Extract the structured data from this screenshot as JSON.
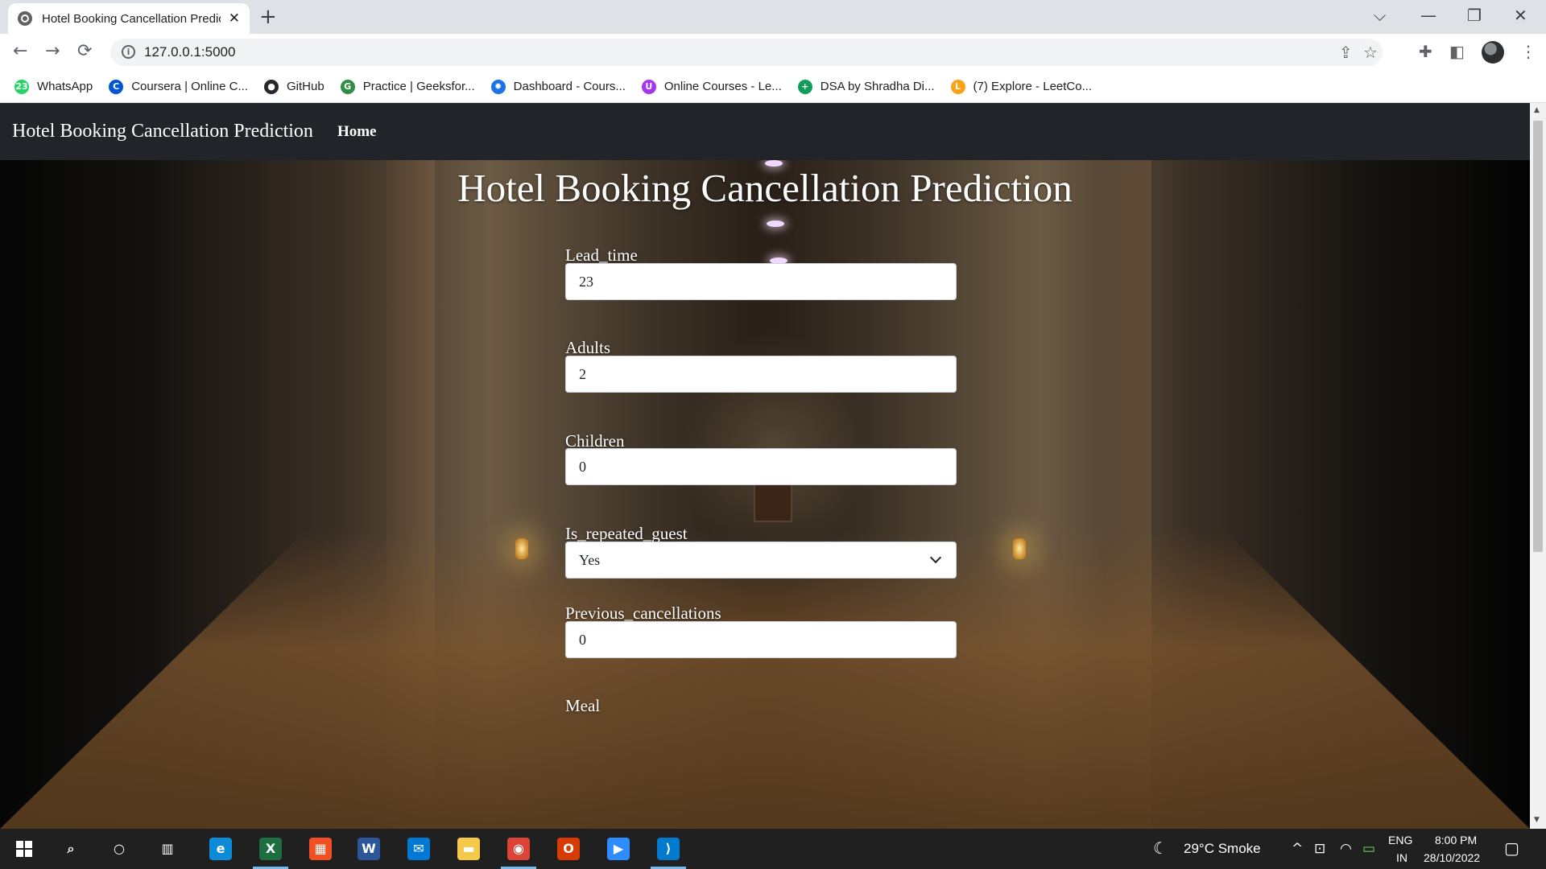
{
  "browser": {
    "tab_title": "Hotel Booking Cancellation Prediction",
    "tab_close": "✕",
    "new_tab": "+",
    "url": "127.0.0.1:5000",
    "window_controls": {
      "minimize": "—",
      "maximize": "❐",
      "close": "✕",
      "tab_search": "⌵"
    },
    "nav": {
      "back": "←",
      "forward": "→",
      "reload": "⟳"
    },
    "bookmarks": [
      {
        "label": "WhatsApp",
        "icon": "whatsapp-icon",
        "glyph": "23",
        "color": "#25d366"
      },
      {
        "label": "Coursera | Online C...",
        "icon": "coursera-icon",
        "glyph": "C",
        "color": "#0056d2"
      },
      {
        "label": "GitHub",
        "icon": "github-icon",
        "glyph": "●",
        "color": "#24292f"
      },
      {
        "label": "Practice | Geeksfor...",
        "icon": "geeksforgeeks-icon",
        "glyph": "G",
        "color": "#2f8d46"
      },
      {
        "label": "Dashboard - Cours...",
        "icon": "sun-icon",
        "glyph": "✹",
        "color": "#1a73e8"
      },
      {
        "label": "Online Courses - Le...",
        "icon": "udemy-icon",
        "glyph": "U",
        "color": "#a435f0"
      },
      {
        "label": "DSA by Shradha Di...",
        "icon": "plus-icon",
        "glyph": "+",
        "color": "#0f9d58"
      },
      {
        "label": "(7) Explore - LeetCo...",
        "icon": "leetcode-icon",
        "glyph": "L",
        "color": "#ffa116"
      }
    ]
  },
  "navbar": {
    "brand": "Hotel Booking Cancellation Prediction",
    "home": "Home"
  },
  "page": {
    "title": "Hotel Booking Cancellation Prediction",
    "fields": [
      {
        "label": "Lead_time",
        "value": "23",
        "type": "input"
      },
      {
        "label": "Adults",
        "value": "2",
        "type": "input"
      },
      {
        "label": "Children",
        "value": "0",
        "type": "input"
      },
      {
        "label": "Is_repeated_guest",
        "value": "Yes",
        "type": "select"
      },
      {
        "label": "Previous_cancellations",
        "value": "0",
        "type": "input"
      },
      {
        "label": "Meal",
        "value": "",
        "type": "input"
      }
    ]
  },
  "taskbar": {
    "apps": [
      {
        "name": "search",
        "glyph": "⌕",
        "color": "transparent"
      },
      {
        "name": "cortana",
        "glyph": "○",
        "color": "transparent"
      },
      {
        "name": "task-view",
        "glyph": "▥",
        "color": "transparent"
      },
      {
        "name": "edge",
        "glyph": "e",
        "color": "#0c8bd6"
      },
      {
        "name": "excel",
        "glyph": "X",
        "color": "#1d6f42"
      },
      {
        "name": "store",
        "glyph": "▦",
        "color": "#f25022"
      },
      {
        "name": "word",
        "glyph": "W",
        "color": "#2b579a"
      },
      {
        "name": "mail",
        "glyph": "✉",
        "color": "#0078d4"
      },
      {
        "name": "file-explorer",
        "glyph": "▬",
        "color": "#f7c948"
      },
      {
        "name": "chrome",
        "glyph": "◉",
        "color": "#db4437"
      },
      {
        "name": "office",
        "glyph": "O",
        "color": "#d83b01"
      },
      {
        "name": "zoom",
        "glyph": "▶",
        "color": "#2d8cff"
      },
      {
        "name": "vscode",
        "glyph": "⟩",
        "color": "#007acc"
      }
    ],
    "weather": "29°C  Smoke",
    "language": "ENG",
    "region": "IN",
    "time": "8:00 PM",
    "date": "28/10/2022"
  }
}
